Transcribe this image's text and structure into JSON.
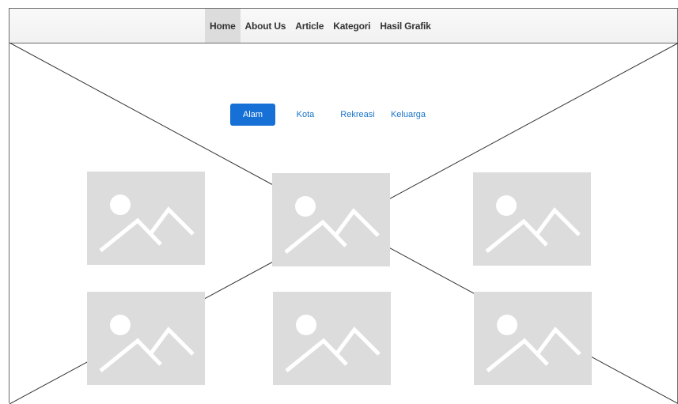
{
  "nav": {
    "items": [
      {
        "label": "Home",
        "active": true
      },
      {
        "label": "About Us"
      },
      {
        "label": "Article"
      },
      {
        "label": "Kategori"
      },
      {
        "label": "Hasil Grafik"
      }
    ]
  },
  "tabs": {
    "items": [
      {
        "label": "Alam",
        "active": true
      },
      {
        "label": "Kota"
      },
      {
        "label": "Rekreasi"
      },
      {
        "label": "Keluarga"
      }
    ]
  },
  "gallery": {
    "count": 6,
    "icon": "image-placeholder-icon"
  },
  "colors": {
    "accent": "#1670d6",
    "link": "#1a73c8",
    "placeholder": "#dcdcdc"
  }
}
